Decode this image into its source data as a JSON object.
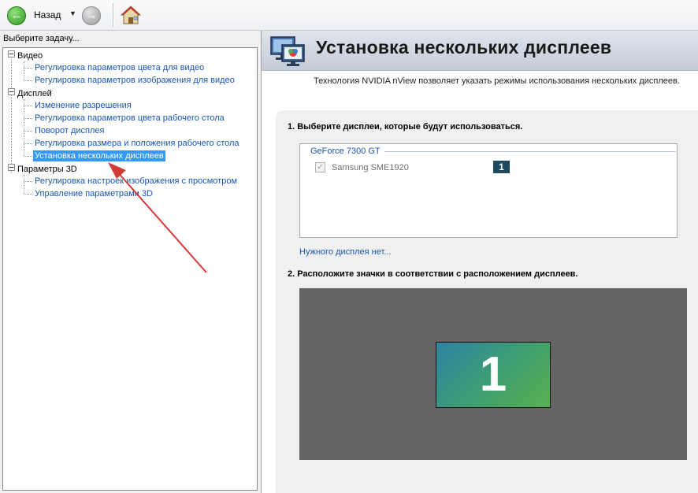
{
  "toolbar": {
    "back_label": "Назад",
    "back_icon": "back-arrow-icon",
    "forward_icon": "forward-arrow-icon",
    "home_icon": "home-icon"
  },
  "sidebar": {
    "task_label": "Выберите задачу...",
    "categories": [
      {
        "label": "Видео",
        "items": [
          {
            "label": "Регулировка параметров цвета для видео"
          },
          {
            "label": "Регулировка параметров изображения для видео"
          }
        ]
      },
      {
        "label": "Дисплей",
        "items": [
          {
            "label": "Изменение разрешения"
          },
          {
            "label": "Регулировка параметров цвета рабочего стола"
          },
          {
            "label": "Поворот дисплея"
          },
          {
            "label": "Регулировка размера и положения рабочего стола"
          },
          {
            "label": "Установка нескольких дисплеев",
            "selected": true
          }
        ]
      },
      {
        "label": "Параметры 3D",
        "items": [
          {
            "label": "Регулировка настроек изображения с просмотром"
          },
          {
            "label": "Управление параметрами 3D"
          }
        ]
      }
    ]
  },
  "header": {
    "title": "Установка нескольких дисплеев",
    "description": "Технология NVIDIA nView позволяет указать режимы использования нескольких дисплеев."
  },
  "section1": {
    "title": "1. Выберите дисплеи, которые будут использоваться.",
    "gpu_label": "GeForce 7300 GT",
    "display": {
      "name": "Samsung SME1920",
      "checked": true,
      "number": "1"
    },
    "missing_link": "Нужного дисплея нет..."
  },
  "section2": {
    "title": "2. Расположите значки в соответствии с расположением дисплеев.",
    "monitor_label": "1"
  },
  "colors": {
    "selection": "#3399ff",
    "link": "#1a55b0",
    "annotation_arrow": "#d33a3a",
    "monitor_gradient_start": "#2f82a4",
    "monitor_gradient_end": "#58b04f"
  }
}
